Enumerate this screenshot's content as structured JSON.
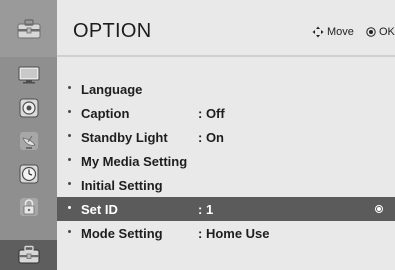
{
  "header": {
    "title": "OPTION",
    "hints": {
      "move_label": "Move",
      "ok_label": "OK"
    }
  },
  "sidebar": {
    "header_icon": "toolbox-icon",
    "items": [
      {
        "icon": "tv-picture-icon"
      },
      {
        "icon": "speaker-audio-icon"
      },
      {
        "icon": "satellite-dish-icon"
      },
      {
        "icon": "clock-time-icon"
      },
      {
        "icon": "padlock-icon"
      },
      {
        "icon": "toolbox-icon",
        "active": true
      }
    ]
  },
  "menu": {
    "items": [
      {
        "label": "Language",
        "value": ""
      },
      {
        "label": "Caption",
        "value": ": Off"
      },
      {
        "label": "Standby Light",
        "value": ": On"
      },
      {
        "label": "My Media Setting",
        "value": ""
      },
      {
        "label": "Initial Setting",
        "value": ""
      },
      {
        "label": "Set ID",
        "value": ": 1",
        "selected": true
      },
      {
        "label": "Mode Setting",
        "value": ": Home Use"
      }
    ]
  },
  "colors": {
    "rail": "#8f8f8f",
    "panel": "#e9e9e9",
    "selected_row": "#5b5b5b"
  }
}
